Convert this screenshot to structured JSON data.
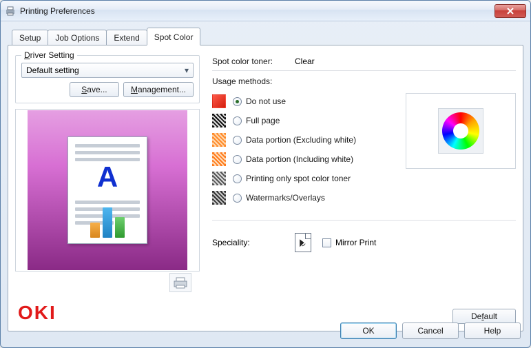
{
  "window": {
    "title": "Printing Preferences"
  },
  "tabs": [
    {
      "label": "Setup"
    },
    {
      "label": "Job Options"
    },
    {
      "label": "Extend"
    },
    {
      "label": "Spot Color"
    }
  ],
  "active_tab_index": 3,
  "driver_setting": {
    "legend": "Driver Setting",
    "selected": "Default setting",
    "save_label": "Save...",
    "management_label": "Management..."
  },
  "logo_text": "OKI",
  "spot_color": {
    "toner_label": "Spot color toner:",
    "toner_value": "Clear",
    "usage_label": "Usage methods:",
    "options": [
      {
        "label": "Do not use",
        "swatch": "sw-red",
        "checked": true
      },
      {
        "label": "Full page",
        "swatch": "sw-stripe",
        "checked": false
      },
      {
        "label": "Data portion (Excluding white)",
        "swatch": "sw-orange",
        "checked": false
      },
      {
        "label": "Data portion (Including white)",
        "swatch": "sw-orange2",
        "checked": false
      },
      {
        "label": "Printing only spot color toner",
        "swatch": "sw-gray",
        "checked": false
      },
      {
        "label": "Watermarks/Overlays",
        "swatch": "sw-gray2",
        "checked": false
      }
    ],
    "speciality_label": "Speciality:",
    "mirror_label": "Mirror Print",
    "default_label": "Default"
  },
  "buttons": {
    "ok": "OK",
    "cancel": "Cancel",
    "help": "Help"
  },
  "colors": {
    "brand_red": "#e11a1a",
    "link_blue": "#1030d0"
  }
}
